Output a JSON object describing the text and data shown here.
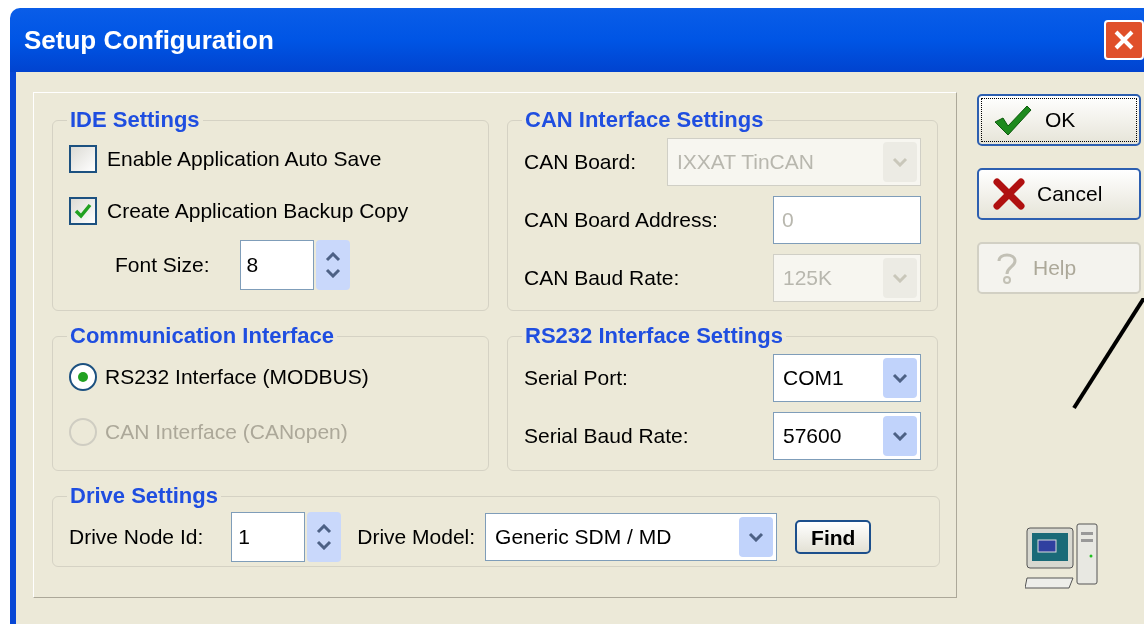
{
  "window": {
    "title": "Setup Configuration"
  },
  "ide_settings": {
    "title": "IDE Settings",
    "checkboxes": [
      {
        "label": "Enable Application Auto Save",
        "checked": false
      },
      {
        "label": "Create Application Backup Copy",
        "checked": true
      }
    ],
    "font_size": {
      "label": "Font Size:",
      "value": "8"
    }
  },
  "can_interface_settings": {
    "title": "CAN Interface Settings",
    "fields": [
      {
        "label": "CAN Board:",
        "value": "IXXAT TinCAN",
        "kind": "dropdown",
        "disabled": true
      },
      {
        "label": "CAN Board Address:",
        "value": "0",
        "kind": "text",
        "disabled": true
      },
      {
        "label": "CAN Baud Rate:",
        "value": "125K",
        "kind": "dropdown",
        "disabled": true
      }
    ]
  },
  "communication_interface": {
    "title": "Communication Interface",
    "options": [
      {
        "label": "RS232 Interface (MODBUS)",
        "selected": true,
        "disabled": false
      },
      {
        "label": "CAN Interface (CANopen)",
        "selected": false,
        "disabled": true
      }
    ]
  },
  "rs232_interface_settings": {
    "title": "RS232 Interface Settings",
    "fields": [
      {
        "label": "Serial Port:",
        "value": "COM1",
        "kind": "dropdown",
        "disabled": false
      },
      {
        "label": "Serial Baud Rate:",
        "value": "57600",
        "kind": "dropdown",
        "disabled": false
      }
    ]
  },
  "drive_settings": {
    "title": "Drive Settings",
    "node_id": {
      "label": "Drive Node Id:",
      "value": "1"
    },
    "model": {
      "label": "Drive Model:",
      "value": "Generic SDM / MD"
    },
    "find_button": "Find"
  },
  "buttons": [
    {
      "label": "OK",
      "kind": "ok",
      "disabled": false
    },
    {
      "label": "Cancel",
      "kind": "cancel",
      "disabled": false
    },
    {
      "label": "Help",
      "kind": "help",
      "disabled": true
    }
  ]
}
